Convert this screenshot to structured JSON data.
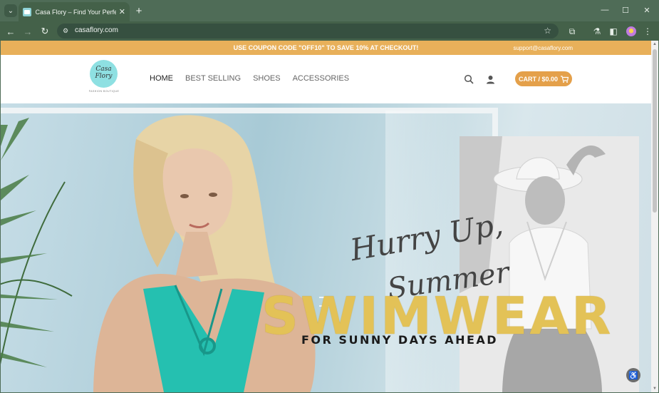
{
  "browser": {
    "tab_title": "Casa Flory – Find Your Perfect",
    "url": "casaflory.com",
    "icons": [
      "tab-search-icon",
      "close-icon",
      "plus-icon",
      "minimize-icon",
      "maximize-icon",
      "close-window-icon",
      "back-arrow-icon",
      "forward-arrow-icon",
      "reload-icon",
      "site-settings-icon",
      "star-icon",
      "extensions-icon",
      "lab-flask-icon",
      "sidebar-icon",
      "profile-avatar-icon",
      "menu-dots-icon"
    ],
    "glyphs": {
      "tab_search": "⌄",
      "tab_close": "✕",
      "new_tab": "+",
      "minimize": "—",
      "maximize": "☐",
      "close_window": "✕",
      "back": "←",
      "forward": "→",
      "reload": "↻",
      "site": "⚙",
      "star": "☆",
      "extensions": "⧉",
      "lab": "⚗",
      "sidebar": "◧",
      "menu": "⋮"
    }
  },
  "site": {
    "promo": {
      "coupon_text": "USE COUPON CODE \"OFF10\" TO SAVE 10% AT CHECKOUT!",
      "email": "support@casaflory.com",
      "color": "#e8b05a"
    },
    "logo": {
      "line1": "Casa",
      "line2": "Flory",
      "tagline": "FASHION BOUTIQUE",
      "color": "#8ee0e2"
    },
    "nav": {
      "items": [
        {
          "label": "HOME",
          "active": true
        },
        {
          "label": "BEST SELLING",
          "active": false
        },
        {
          "label": "SHOES",
          "active": false
        },
        {
          "label": "ACCESSORIES",
          "active": false
        }
      ]
    },
    "header_icons": {
      "search": "⚲",
      "account": "👤",
      "cart": "🛒"
    },
    "cart": {
      "label": "CART / $0.00",
      "color": "#e4a04a"
    },
    "hero": {
      "script_line1": "Hurry Up,",
      "script_line2": "Summer",
      "headline": "SWIMWEAR",
      "subline": "FOR SUNNY DAYS AHEAD",
      "headline_color": "#e3c257"
    },
    "accessibility_glyph": "♿"
  }
}
